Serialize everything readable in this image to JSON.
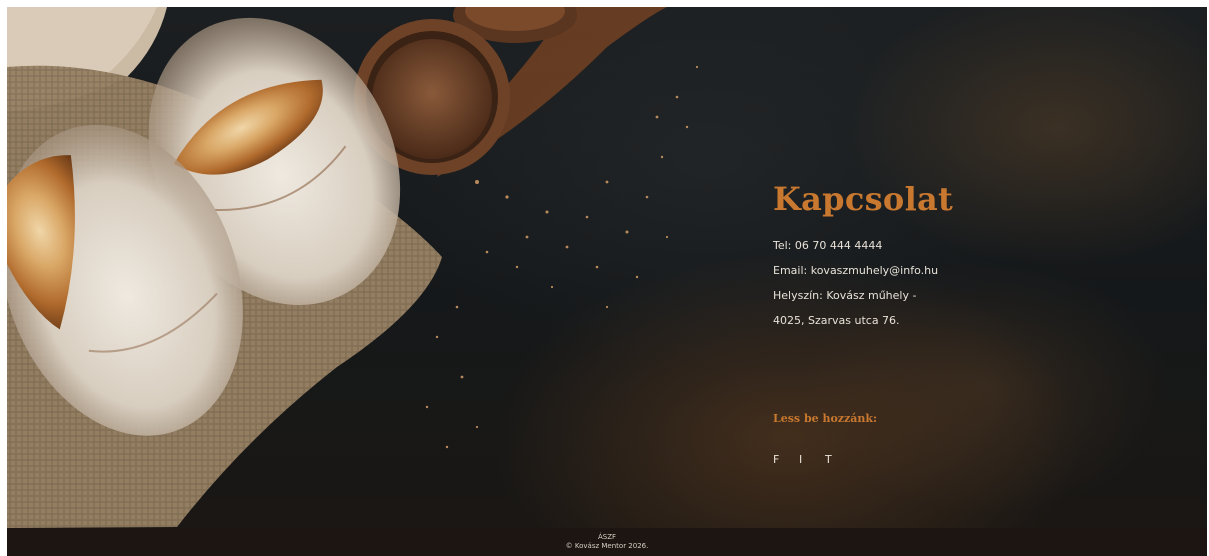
{
  "contact": {
    "title": "Kapcsolat",
    "phone": "Tel: 06 70 444 4444",
    "email": "Email: kovaszmuhely@info.hu",
    "location_line1": "Helyszín: Kovász műhely -",
    "location_line2": "4025, Szarvas utca 76."
  },
  "social": {
    "title": "Less be hozzánk:",
    "links": [
      {
        "label": "F",
        "icon": "facebook-icon"
      },
      {
        "label": "I",
        "icon": "instagram-icon"
      },
      {
        "label": "T",
        "icon": "twitter-icon"
      }
    ]
  },
  "footer": {
    "line1": "ÁSZF",
    "line2": "© Kovász Mentor 2026."
  },
  "colors": {
    "accent": "#c8782f",
    "text": "#e8e2d8",
    "footer_bg": "#1c1511"
  }
}
